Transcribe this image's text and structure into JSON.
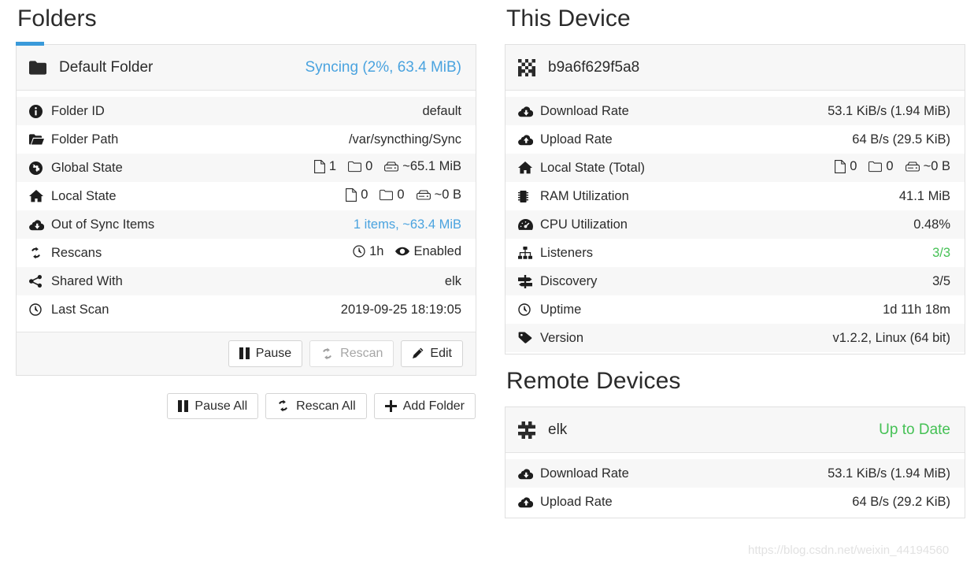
{
  "sections": {
    "folders_title": "Folders",
    "this_device_title": "This Device",
    "remote_devices_title": "Remote Devices"
  },
  "colors": {
    "accent_blue": "#3a9ada",
    "link_blue": "#4aa3df",
    "status_green": "#45c155",
    "panel_head_bg": "#f7f7f7",
    "row_alt_bg": "#f7f7f7",
    "border": "#e0e0e0"
  },
  "folder": {
    "icon": "folder-icon",
    "name": "Default Folder",
    "status": "Syncing (2%, 63.4 MiB)",
    "rows": [
      {
        "icon": "info-circle-icon",
        "label": "Folder ID",
        "value": "default"
      },
      {
        "icon": "folder-open-icon",
        "label": "Folder Path",
        "value": "/var/syncthing/Sync"
      },
      {
        "icon": "globe-icon",
        "label": "Global State",
        "stats": {
          "files": "1",
          "folders": "0",
          "size": "~65.1 MiB"
        }
      },
      {
        "icon": "home-icon",
        "label": "Local State",
        "stats": {
          "files": "0",
          "folders": "0",
          "size": "~0 B"
        }
      },
      {
        "icon": "cloud-download-icon",
        "label": "Out of Sync Items",
        "value": "1 items, ~63.4 MiB",
        "link": true
      },
      {
        "icon": "refresh-icon",
        "label": "Rescans",
        "rescan": {
          "interval": "1h",
          "watch": "Enabled"
        }
      },
      {
        "icon": "share-alt-icon",
        "label": "Shared With",
        "value": "elk"
      },
      {
        "icon": "clock-icon",
        "label": "Last Scan",
        "value": "2019-09-25 18:19:05"
      }
    ],
    "buttons": [
      {
        "icon": "pause-icon",
        "label": "Pause",
        "disabled": false
      },
      {
        "icon": "refresh-icon",
        "label": "Rescan",
        "disabled": true
      },
      {
        "icon": "pencil-icon",
        "label": "Edit",
        "disabled": false
      }
    ]
  },
  "global_actions": [
    {
      "icon": "pause-icon",
      "label": "Pause All"
    },
    {
      "icon": "refresh-icon",
      "label": "Rescan All"
    },
    {
      "icon": "plus-icon",
      "label": "Add Folder"
    }
  ],
  "this_device": {
    "icon": "identicon",
    "name": "b9a6f629f5a8",
    "rows": [
      {
        "icon": "cloud-download-icon",
        "label": "Download Rate",
        "value": "53.1 KiB/s (1.94 MiB)"
      },
      {
        "icon": "cloud-upload-icon",
        "label": "Upload Rate",
        "value": "64 B/s (29.5 KiB)"
      },
      {
        "icon": "home-icon",
        "label": "Local State (Total)",
        "stats": {
          "files": "0",
          "folders": "0",
          "size": "~0 B"
        }
      },
      {
        "icon": "memory-icon",
        "label": "RAM Utilization",
        "value": "41.1 MiB"
      },
      {
        "icon": "tachometer-icon",
        "label": "CPU Utilization",
        "value": "0.48%"
      },
      {
        "icon": "sitemap-icon",
        "label": "Listeners",
        "value": "3/3",
        "green": true
      },
      {
        "icon": "signpost-icon",
        "label": "Discovery",
        "value": "3/5"
      },
      {
        "icon": "clock-icon",
        "label": "Uptime",
        "value": "1d 11h 18m"
      },
      {
        "icon": "tag-icon",
        "label": "Version",
        "value": "v1.2.2, Linux (64 bit)"
      }
    ]
  },
  "remote_device": {
    "icon": "identicon",
    "name": "elk",
    "status": "Up to Date",
    "rows": [
      {
        "icon": "cloud-download-icon",
        "label": "Download Rate",
        "value": "53.1 KiB/s (1.94 MiB)"
      },
      {
        "icon": "cloud-upload-icon",
        "label": "Upload Rate",
        "value": "64 B/s (29.2 KiB)"
      }
    ]
  },
  "watermark": "https://blog.csdn.net/weixin_44194560"
}
